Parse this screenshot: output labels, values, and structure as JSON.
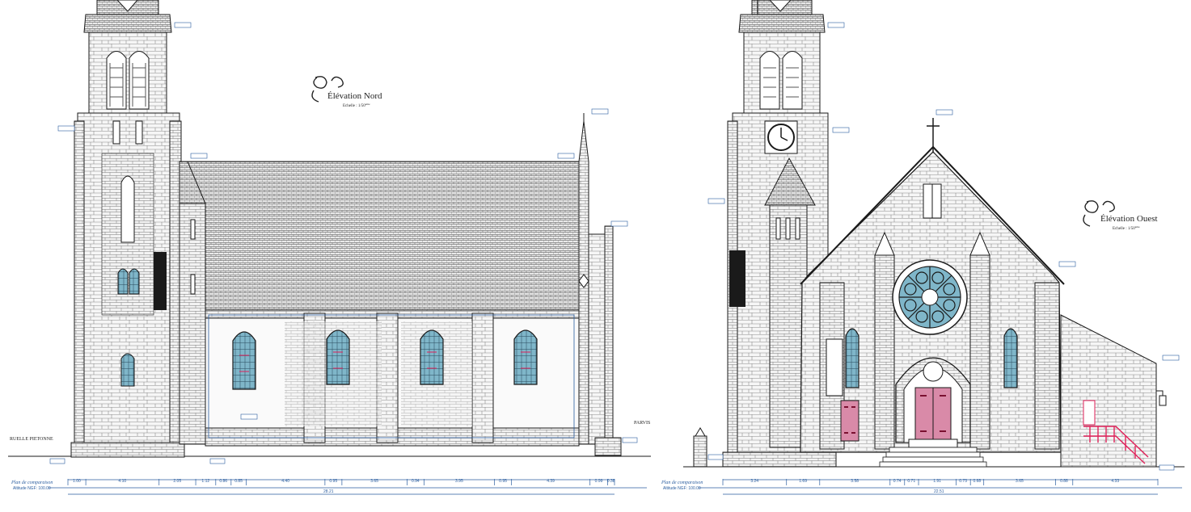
{
  "north": {
    "title": "Élévation Nord",
    "scale_prefix": "Echelle : 1/50",
    "scale_suffix": "ème",
    "left_label": "RUELLE PIETONNE",
    "right_label": "PARVIS",
    "datum_label": "Plan de comparaison",
    "datum_sub": "Altitude NGF: 100.00",
    "dims": [
      "1.00",
      "4.10",
      "2.05",
      "1.12",
      "0.86",
      "0.85",
      "4.40",
      "0.95",
      "3.65",
      "0.94",
      "3.95",
      "0.95",
      "4.39",
      "0.99",
      "0.38"
    ],
    "total": "28.21"
  },
  "west": {
    "title": "Élévation Ouest",
    "scale_prefix": "Echelle : 1/50",
    "scale_suffix": "ème",
    "datum_label": "Plan de comparaison",
    "datum_sub": "Altitude NGF: 100.00",
    "dims": [
      "3.24",
      "1.69",
      "3.58",
      "0.74",
      "0.71",
      "1.91",
      "0.73",
      "0.68",
      "3.65",
      "0.88",
      "4.33"
    ],
    "total": "22.51"
  },
  "colors": {
    "line": "#1a1a1a",
    "stone": "#f4f4f4",
    "glass": "#7fb6c9",
    "door": "#d98aa8",
    "handrail": "#e0225a",
    "dimension": "#2a5d9f"
  }
}
